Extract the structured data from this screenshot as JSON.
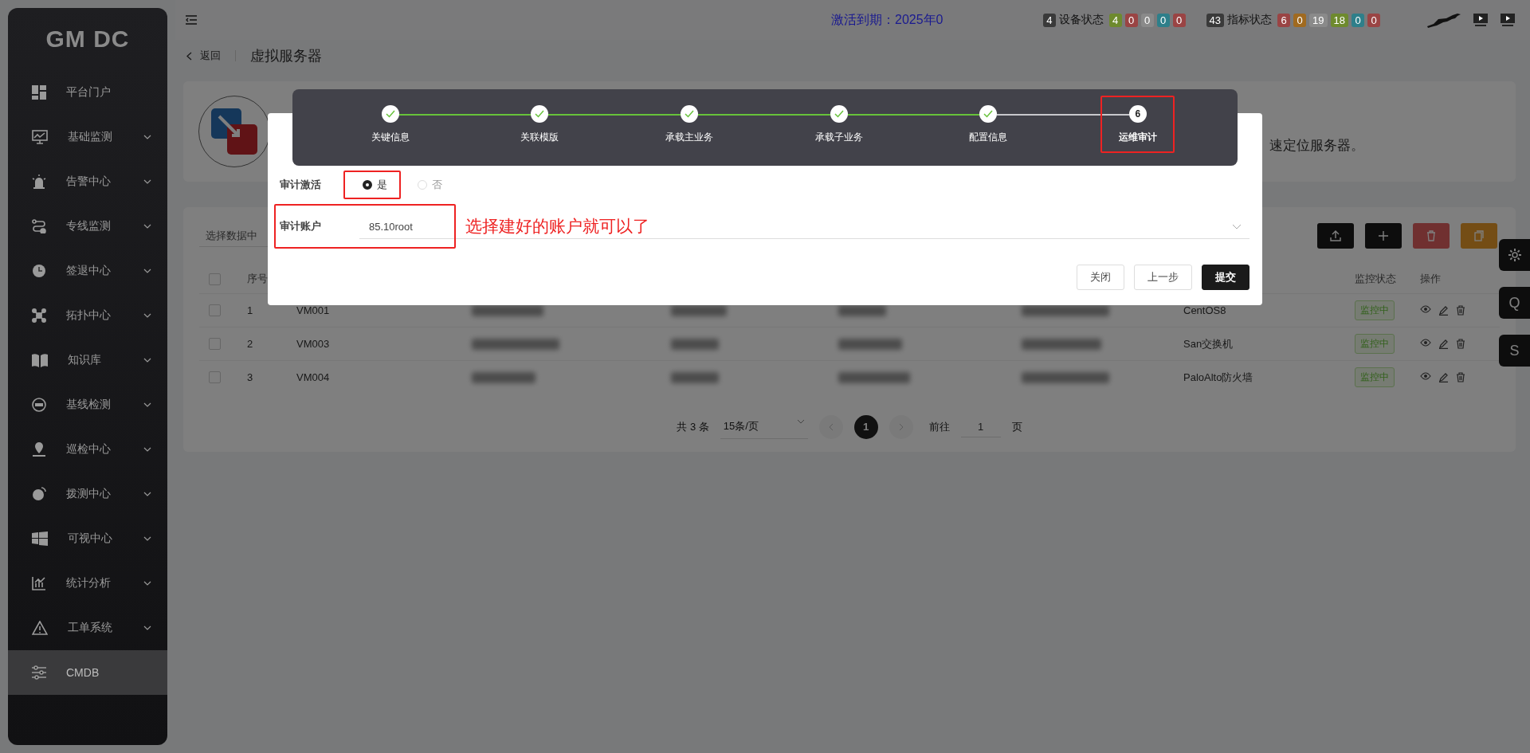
{
  "sidebar": {
    "logo": "GM DC",
    "items": [
      {
        "label": "平台门户",
        "expandable": false,
        "selected": false
      },
      {
        "label": "基础监测",
        "expandable": true,
        "selected": false
      },
      {
        "label": "告警中心",
        "expandable": true,
        "selected": false
      },
      {
        "label": "专线监测",
        "expandable": true,
        "selected": false
      },
      {
        "label": "签退中心",
        "expandable": true,
        "selected": false
      },
      {
        "label": "拓扑中心",
        "expandable": true,
        "selected": false
      },
      {
        "label": "知识库",
        "expandable": true,
        "selected": false
      },
      {
        "label": "基线检测",
        "expandable": true,
        "selected": false
      },
      {
        "label": "巡检中心",
        "expandable": true,
        "selected": false
      },
      {
        "label": "拨测中心",
        "expandable": true,
        "selected": false
      },
      {
        "label": "可视中心",
        "expandable": true,
        "selected": false
      },
      {
        "label": "统计分析",
        "expandable": true,
        "selected": false
      },
      {
        "label": "工单系统",
        "expandable": true,
        "selected": false
      },
      {
        "label": "CMDB",
        "expandable": false,
        "selected": true
      }
    ]
  },
  "topbar": {
    "activation": "激活到期：2025年0",
    "groups": [
      {
        "count": "4",
        "label": "设备状态",
        "badges": [
          {
            "text": "4",
            "color": "#6e8a2e"
          },
          {
            "text": "0",
            "color": "#9a4444"
          },
          {
            "text": "0",
            "color": "#8a8a8a"
          },
          {
            "text": "0",
            "color": "#2e7f8a"
          },
          {
            "text": "0",
            "color": "#9a4444"
          }
        ]
      },
      {
        "count": "43",
        "label": "指标状态",
        "badges": [
          {
            "text": "6",
            "color": "#9a4444"
          },
          {
            "text": "0",
            "color": "#a06a20"
          },
          {
            "text": "19",
            "color": "#8a8a8a"
          },
          {
            "text": "18",
            "color": "#6e8a2e"
          },
          {
            "text": "0",
            "color": "#2e7f8a"
          },
          {
            "text": "0",
            "color": "#9a4444"
          }
        ]
      }
    ]
  },
  "float_buttons": [
    {
      "kind": "settings"
    },
    {
      "kind": "letter",
      "label": "Q"
    },
    {
      "kind": "letter",
      "label": "S"
    }
  ],
  "breadcrumb": {
    "back": "返回",
    "title": "虚拟服务器"
  },
  "info_card": {
    "description": "速定位服务器。"
  },
  "table_card": {
    "search": {
      "placeholder": "选择数据中"
    },
    "all_checked": false,
    "columns": [
      {
        "label": "序号"
      },
      {
        "label": "监控状态"
      },
      {
        "label": "操作"
      }
    ],
    "rows": [
      {
        "index": "1",
        "name": "VM001",
        "type": "CentOS8",
        "status": "监控中",
        "checked": false
      },
      {
        "index": "2",
        "name": "VM003",
        "type": "San交换机",
        "status": "监控中",
        "checked": false
      },
      {
        "index": "3",
        "name": "VM004",
        "type": "PaloAlto防火墙",
        "status": "监控中",
        "checked": false
      }
    ],
    "pagination": {
      "total": "共 3 条",
      "page_size": "15条/页",
      "pages": [
        {
          "label": "1",
          "selected": true
        }
      ],
      "goto_label": "前往",
      "goto_value": "1",
      "goto_suffix": "页"
    }
  },
  "dialog": {
    "steps": [
      {
        "label": "关键信息",
        "done": true,
        "highlighted": false
      },
      {
        "label": "关联模版",
        "done": true,
        "highlighted": false
      },
      {
        "label": "承载主业务",
        "done": true,
        "highlighted": false
      },
      {
        "label": "承载子业务",
        "done": true,
        "highlighted": false
      },
      {
        "label": "配置信息",
        "done": true,
        "highlighted": false
      },
      {
        "label": "运维审计",
        "done": false,
        "number": "6",
        "highlighted": true
      }
    ],
    "radio_field": {
      "label": "审计激活",
      "options": [
        {
          "label": "是",
          "selected": true,
          "highlighted": true
        },
        {
          "label": "否",
          "selected": false,
          "highlighted": false
        }
      ]
    },
    "select_field": {
      "label": "审计账户",
      "value": "85.10root",
      "highlighted": true
    },
    "note": "选择建好的账户就可以了",
    "buttons": [
      {
        "label": "关闭",
        "kind": "default"
      },
      {
        "label": "上一步",
        "kind": "default"
      },
      {
        "label": "提交",
        "kind": "primary"
      }
    ]
  }
}
